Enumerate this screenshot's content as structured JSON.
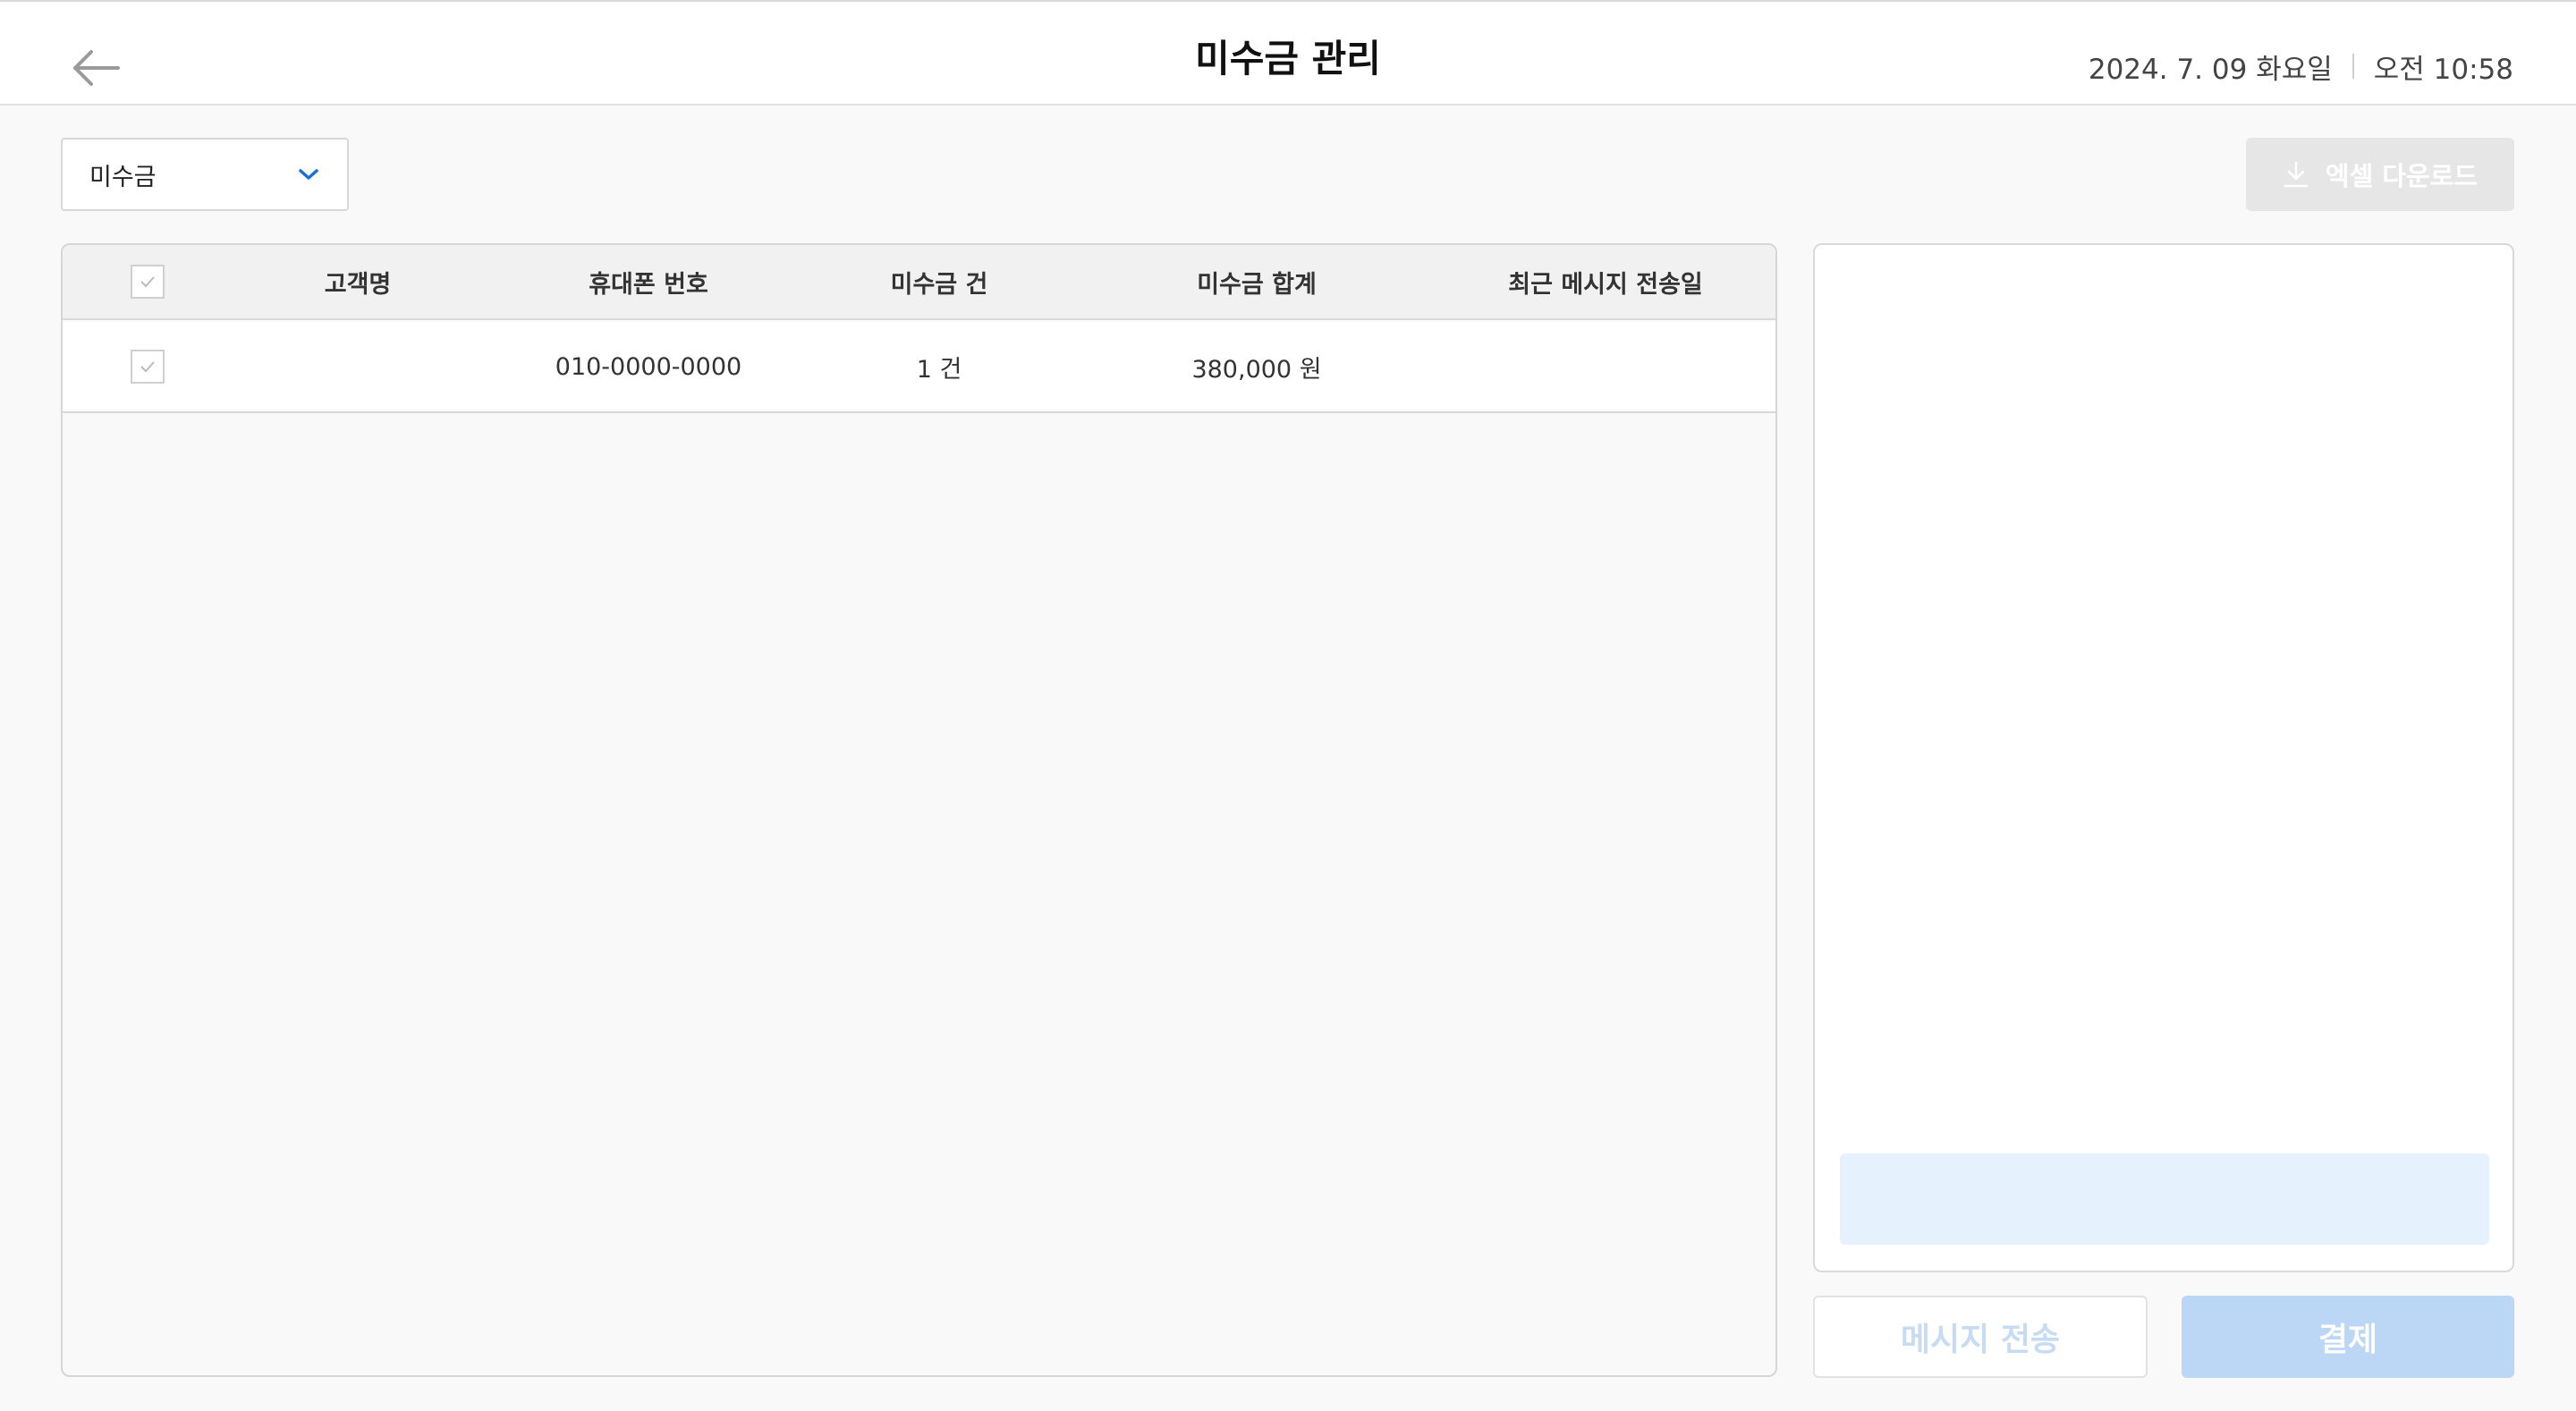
{
  "header": {
    "title": "미수금 관리",
    "date": "2024. 7. 09 화요일",
    "time": "오전 10:58",
    "back_icon": "arrow-left-icon"
  },
  "filter": {
    "selected": "미수금",
    "icon": "chevron-down-icon"
  },
  "toolbar": {
    "excel_label": "엑셀 다운로드",
    "excel_icon": "download-icon"
  },
  "table": {
    "columns": [
      "고객명",
      "휴대폰 번호",
      "미수금 건",
      "미수금 합계",
      "최근 메시지 전송일"
    ],
    "rows": [
      {
        "checked": true,
        "name": "",
        "phone": "010-0000-0000",
        "count": "1 건",
        "total": "380,000 원",
        "last_sent": ""
      }
    ]
  },
  "actions": {
    "send_label": "메시지 전송",
    "pay_label": "결제"
  },
  "colors": {
    "accent": "#1a6fd6",
    "pay_button": "#bcd6f6",
    "message_box": "#e5f1fd",
    "disabled_button": "#e6e6e6"
  }
}
